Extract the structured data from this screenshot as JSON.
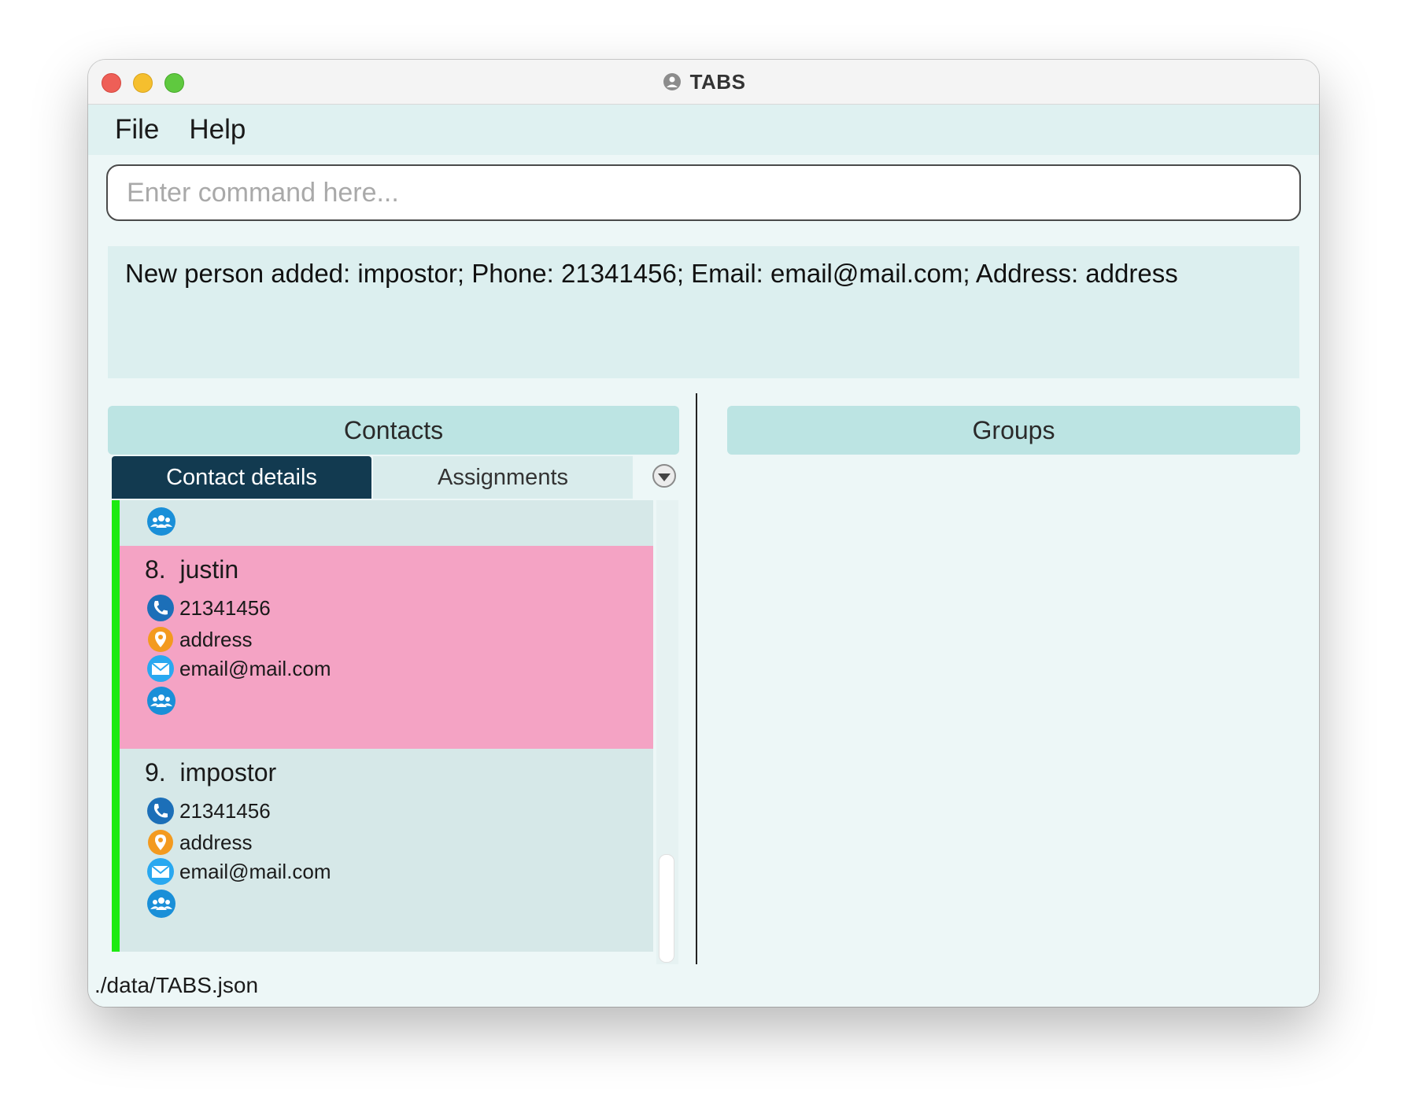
{
  "window": {
    "title": "TABS"
  },
  "menu": {
    "items": [
      "File",
      "Help"
    ]
  },
  "command": {
    "value": "",
    "placeholder": "Enter command here..."
  },
  "result": {
    "text": "New person added: impostor; Phone: 21341456; Email: email@mail.com; Address: address"
  },
  "contacts": {
    "header": "Contacts",
    "tabs": [
      {
        "label": "Contact details",
        "active": true
      },
      {
        "label": "Assignments",
        "active": false
      }
    ],
    "cards": [
      {
        "index": "8.",
        "name": "justin",
        "phone": "21341456",
        "address": "address",
        "email": "email@mail.com",
        "selected": true,
        "highlight_color": "#f4a3c4"
      },
      {
        "index": "9.",
        "name": "impostor",
        "phone": "21341456",
        "address": "address",
        "email": "email@mail.com",
        "selected": false
      }
    ]
  },
  "groups": {
    "header": "Groups"
  },
  "status": {
    "file_path": "./data/TABS.json"
  },
  "icons": {
    "phone": "phone-icon",
    "address": "location-pin-icon",
    "email": "mail-icon",
    "group": "group-icon"
  },
  "colors": {
    "accent_bar": "#1dea12",
    "active_tab": "#123a50",
    "panel_header": "#bce4e3"
  }
}
